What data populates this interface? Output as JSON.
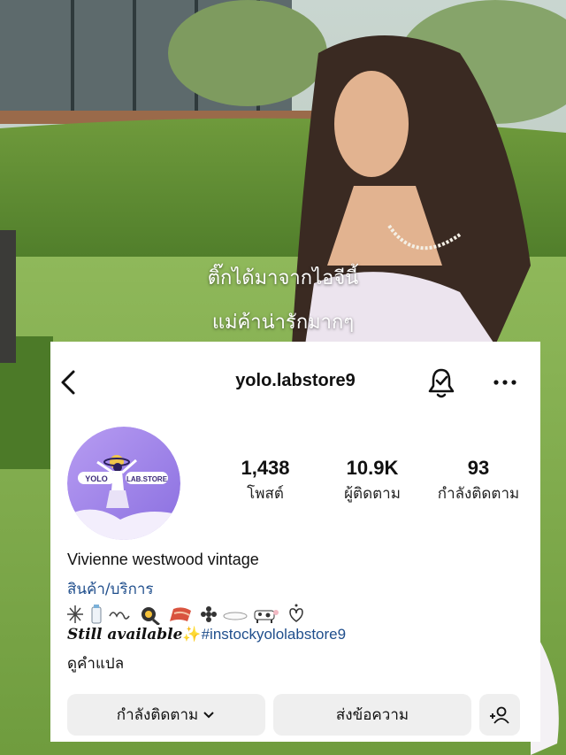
{
  "overlay_caption": {
    "line1": "ติ๊กได้มาจากไอจีนี้",
    "line2": "แม่ค้าน่ารักมากๆ"
  },
  "profile": {
    "username": "yolo.labstore9",
    "avatar_text_left": "YOLO",
    "avatar_text_right": "LAB.STORE",
    "stats": [
      {
        "value": "1,438",
        "label": "โพสต์"
      },
      {
        "value": "10.9K",
        "label": "ผู้ติดตาม"
      },
      {
        "value": "93",
        "label": "กำลังติดตาม"
      }
    ],
    "display_name": "Vivienne westwood vintage",
    "category": "สินค้า/บริการ",
    "bio_emoji_icons": [
      "sparkle-icon",
      "milk-bottle-icon",
      "ribbon-icon",
      "frying-pan-egg-icon",
      "bacon-icon",
      "flower-icon",
      "plate-icon",
      "cow-icon",
      "heart-outline-icon"
    ],
    "bio_status": "Still available",
    "bio_sparkle": "✨",
    "bio_hashtag": "#instockyololabstore9",
    "translate_label": "ดูคำแปล"
  },
  "actions": {
    "following_label": "กำลังติดตาม",
    "message_label": "ส่งข้อความ"
  },
  "colors": {
    "link_blue": "#1f4e8c",
    "button_bg": "#efefef",
    "avatar_purple": "#9b7fe6"
  }
}
